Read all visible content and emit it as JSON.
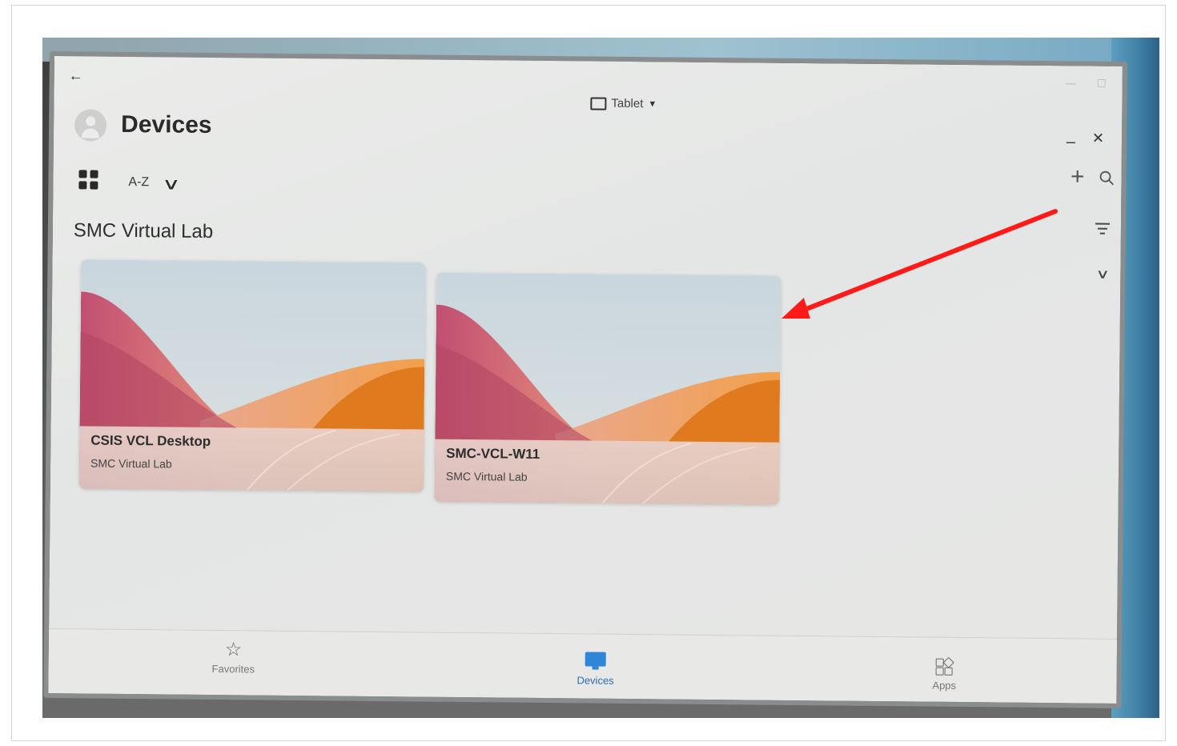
{
  "window": {
    "back_icon": "arrow-left-icon",
    "device_mode_label": "Tablet",
    "device_mode_icon": "tablet-icon",
    "minimize_label": "–",
    "close_label": "✕"
  },
  "header": {
    "title": "Devices",
    "avatar_icon": "user-avatar-icon"
  },
  "toolbar": {
    "view_icon": "grid-view-icon",
    "sort_label": "A-Z",
    "sort_icon": "chevron-down-icon",
    "add_icon": "plus-icon",
    "search_icon": "search-icon",
    "filter_icon": "filter-icon",
    "collapse_icon": "chevron-down-icon"
  },
  "group": {
    "title": "SMC Virtual Lab",
    "devices": [
      {
        "name": "CSIS VCL Desktop",
        "subtitle": "SMC Virtual Lab"
      },
      {
        "name": "SMC-VCL-W11",
        "subtitle": "SMC Virtual Lab"
      }
    ]
  },
  "bottom_nav": {
    "items": [
      {
        "label": "Favorites",
        "icon": "star-icon",
        "active": false
      },
      {
        "label": "Devices",
        "icon": "monitor-icon",
        "active": true
      },
      {
        "label": "Apps",
        "icon": "apps-icon",
        "active": false
      }
    ]
  },
  "colors": {
    "accent": "#2f86d8",
    "annotation_arrow": "#ff1a1a"
  }
}
